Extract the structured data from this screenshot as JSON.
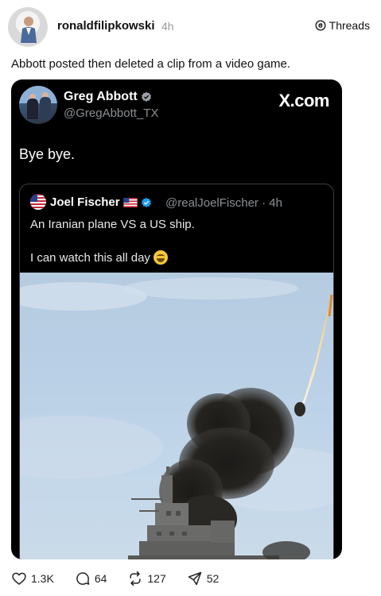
{
  "post": {
    "username": "ronaldfilipkowski",
    "time": "4h",
    "source_label": "Threads",
    "caption": "Abbott posted then deleted a clip from a video game."
  },
  "tweet": {
    "display_name": "Greg Abbott",
    "handle": "@GregAbbott_TX",
    "site_label": "X.com",
    "text": "Bye bye."
  },
  "quoted": {
    "display_name": "Joel Fischer",
    "meta": "@realJoelFischer · 4h",
    "line1": "An Iranian plane VS a US ship.",
    "line2": "I can watch this all day"
  },
  "actions": {
    "likes": "1.3K",
    "comments": "64",
    "reposts": "127",
    "shares": "52"
  },
  "colors": {
    "verified": "#1d9bf0",
    "tweet_background": "#000000"
  },
  "icons": [
    "threads-icon",
    "verified-badge-icon",
    "us-flag-icon",
    "heart-icon",
    "comment-icon",
    "repost-icon",
    "share-icon"
  ]
}
